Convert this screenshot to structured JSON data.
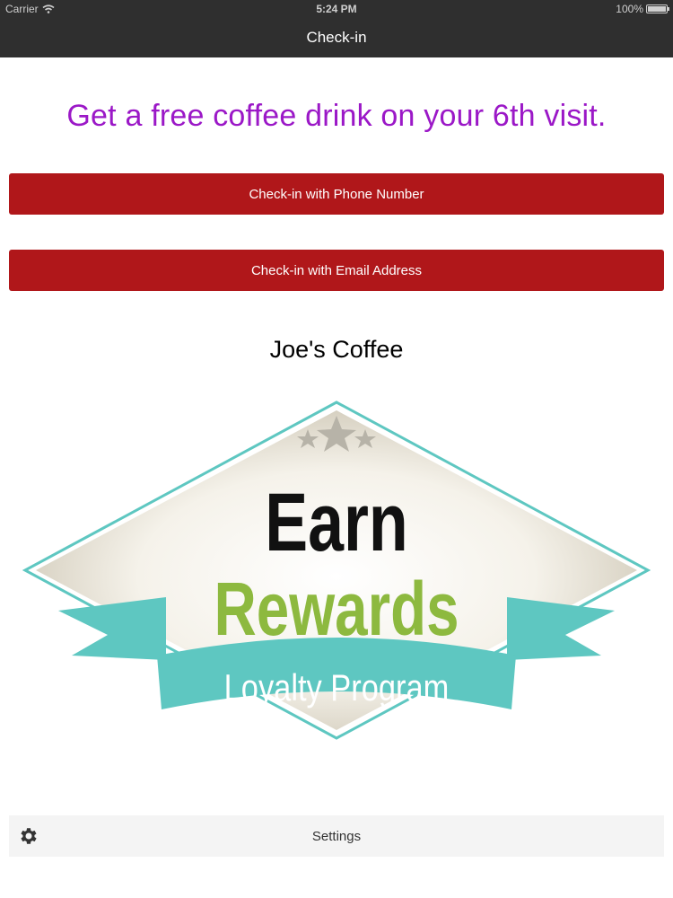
{
  "status": {
    "carrier": "Carrier",
    "time": "5:24 PM",
    "battery": "100%"
  },
  "nav": {
    "title": "Check-in"
  },
  "promo": {
    "text": "Get a free coffee drink on your 6th visit."
  },
  "buttons": {
    "phone": "Check-in with Phone Number",
    "email": "Check-in with Email Address"
  },
  "shop": {
    "name": "Joe's Coffee"
  },
  "logo": {
    "line1": "Earn",
    "line2": "Rewards",
    "banner": "Loyalty Program"
  },
  "settings": {
    "label": "Settings"
  },
  "colors": {
    "accent_purple": "#9b18c7",
    "button_red": "#b0171a",
    "nav_dark": "#2f2f2f",
    "teal": "#5ec7c1",
    "green": "#8db93f"
  }
}
